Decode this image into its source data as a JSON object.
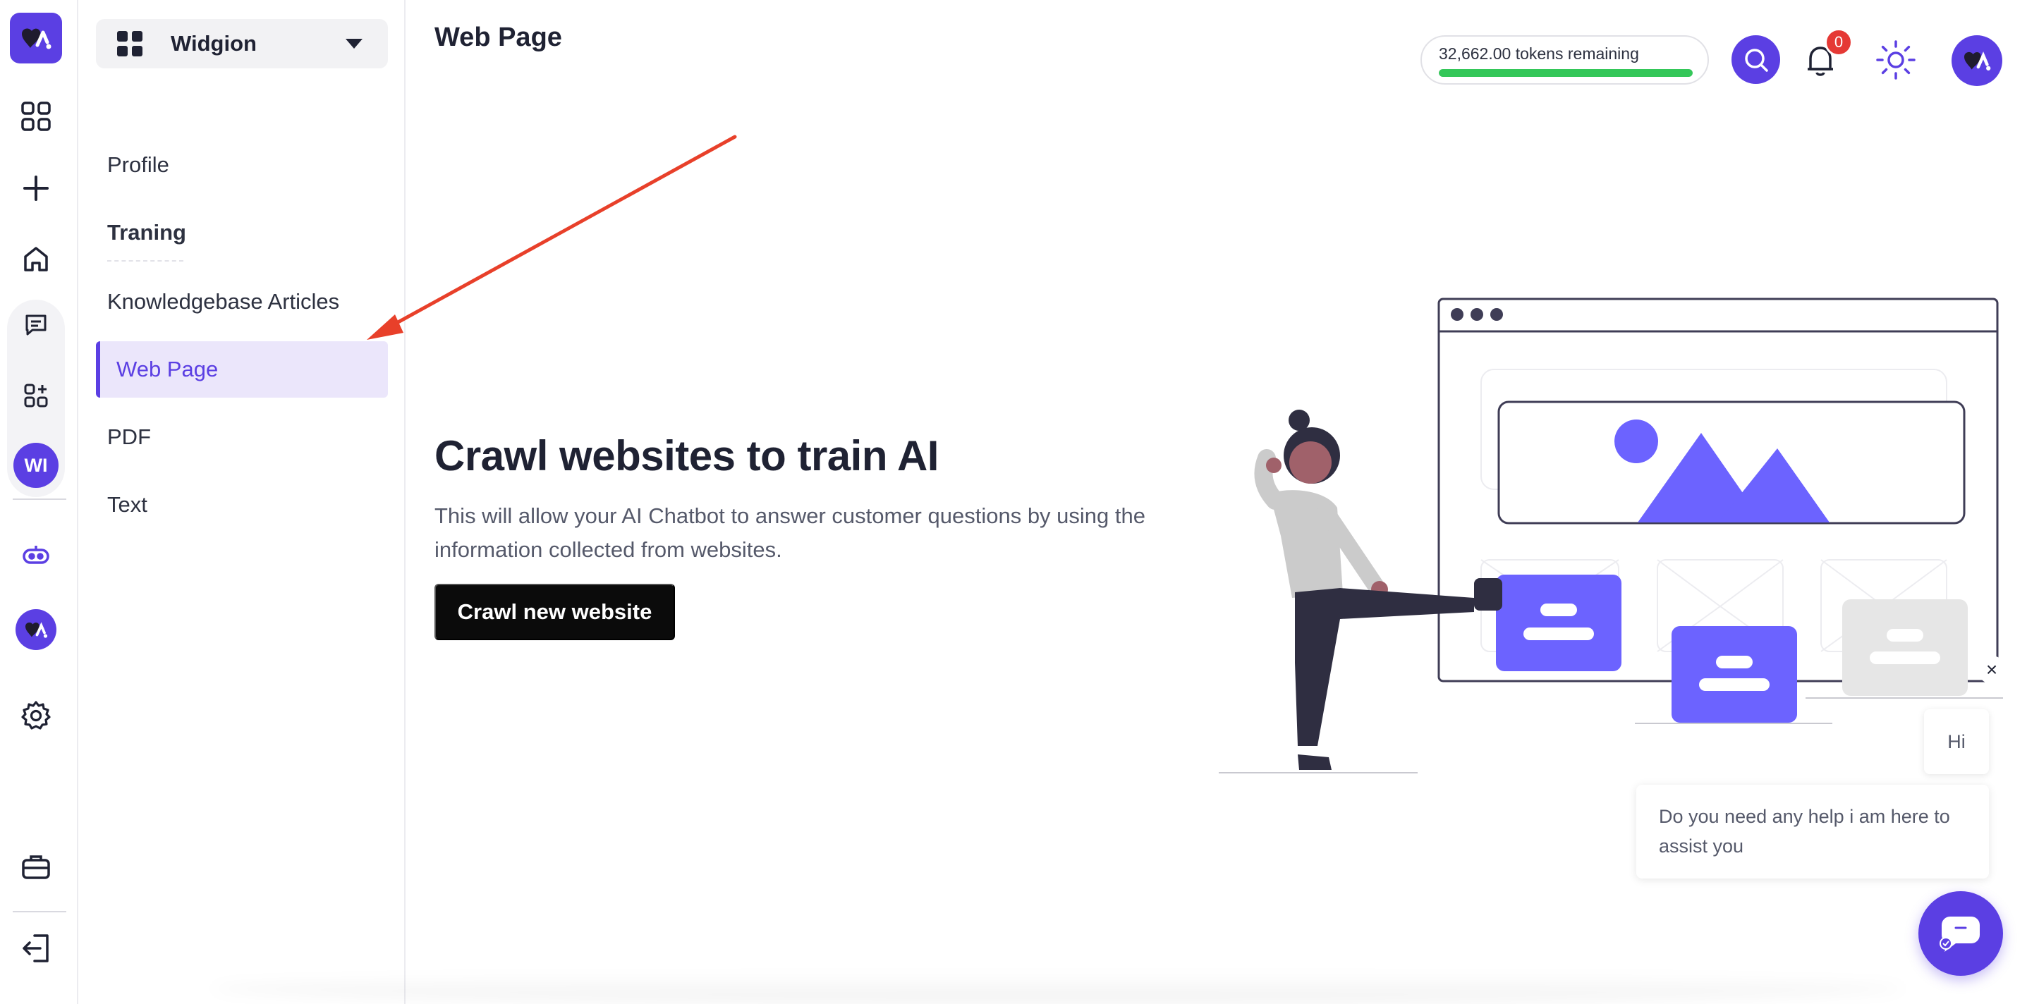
{
  "app": {
    "accent_color": "#5b3fe3",
    "logo_icon": "widgion-logo-icon"
  },
  "rail": {
    "items": [
      {
        "icon": "dashboard-grid-icon"
      },
      {
        "icon": "plus-icon"
      },
      {
        "icon": "home-icon"
      },
      {
        "icon": "chat-icon"
      },
      {
        "icon": "widgets-add-icon"
      },
      {
        "icon": "robot-icon"
      },
      {
        "icon": "settings-gear-icon"
      },
      {
        "icon": "briefcase-icon"
      },
      {
        "icon": "logout-icon"
      }
    ],
    "workspace_initials": "WI"
  },
  "workspace": {
    "name": "Widgion"
  },
  "sidebar": {
    "items": [
      {
        "label": "Profile"
      },
      {
        "label": "Traning"
      },
      {
        "label": "Knowledgebase Articles"
      },
      {
        "label": "Web Page"
      },
      {
        "label": "PDF"
      },
      {
        "label": "Text"
      }
    ],
    "active_index": 3
  },
  "header": {
    "title": "Web Page",
    "tokens_text": "32,662.00 tokens remaining",
    "tokens_fraction": 1.0,
    "tokens_bar_color": "#34c759",
    "notification_count": "0"
  },
  "hero": {
    "title": "Crawl websites to train AI",
    "description": "This will allow your AI Chatbot to answer customer questions by using the information collected from websites.",
    "button_label": "Crawl new website"
  },
  "chat": {
    "greeting": "Hi",
    "message": "Do you need any help i am here to assist you",
    "close_symbol": "×"
  },
  "annotation": {
    "arrow_color": "#e8402a"
  }
}
